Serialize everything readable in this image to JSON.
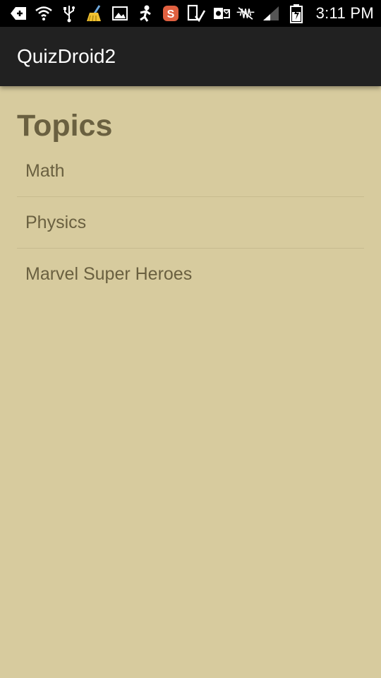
{
  "status_bar": {
    "time": "3:11 PM",
    "icons": [
      "add-icon",
      "wifi-icon",
      "usb-icon",
      "cleaner-icon",
      "image-icon",
      "person-icon",
      "s-app-icon",
      "device-check-icon",
      "outlook-icon",
      "mute-icon",
      "signal-icon",
      "battery-charging-icon"
    ]
  },
  "app_bar": {
    "title": "QuizDroid2"
  },
  "main": {
    "heading": "Topics",
    "topics": [
      {
        "label": "Math"
      },
      {
        "label": "Physics"
      },
      {
        "label": "Marvel Super Heroes"
      }
    ]
  },
  "colors": {
    "background": "#d7cb9e",
    "app_bar": "#212121",
    "text": "#6a6040",
    "divider": "#c7bb8f"
  }
}
